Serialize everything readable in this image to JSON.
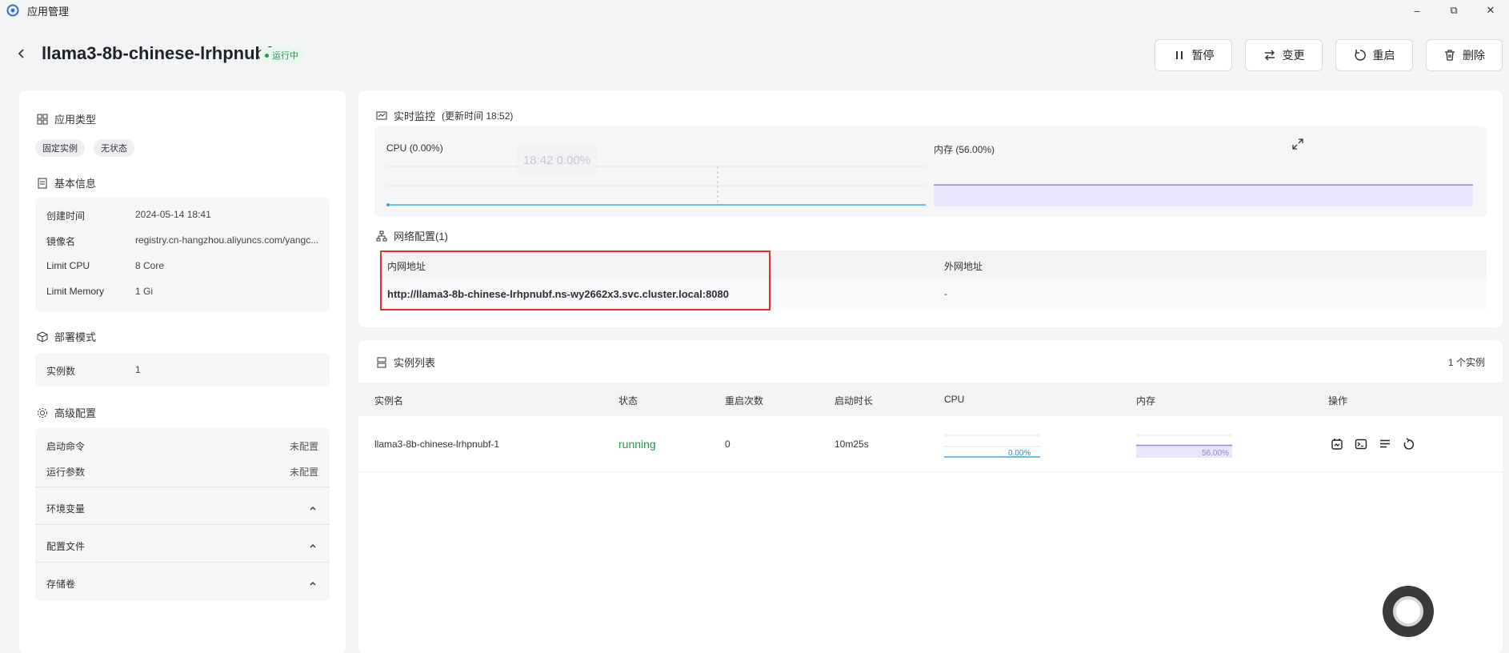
{
  "window": {
    "title": "应用管理",
    "minimize": "–",
    "restore": "⧉",
    "close": "✕"
  },
  "header": {
    "title": "llama3-8b-chinese-lrhpnubf",
    "status": "运行中",
    "buttons": {
      "pause": "暂停",
      "change": "变更",
      "restart": "重启",
      "delete": "删除"
    }
  },
  "left": {
    "app_type": {
      "title": "应用类型",
      "tags": [
        "固定实例",
        "无状态"
      ]
    },
    "basic": {
      "title": "基本信息",
      "rows": [
        {
          "k": "创建时间",
          "v": "2024-05-14 18:41"
        },
        {
          "k": "镜像名",
          "v": "registry.cn-hangzhou.aliyuncs.com/yangc..."
        },
        {
          "k": "Limit CPU",
          "v": "8 Core"
        },
        {
          "k": "Limit Memory",
          "v": "1 Gi"
        }
      ]
    },
    "deploy": {
      "title": "部署模式",
      "k": "实例数",
      "v": "1"
    },
    "advanced": {
      "title": "高级配置",
      "rows": [
        {
          "k": "启动命令",
          "v": "未配置"
        },
        {
          "k": "运行参数",
          "v": "未配置"
        }
      ],
      "collapses": [
        "环境变量",
        "配置文件",
        "存储卷"
      ]
    }
  },
  "monitor": {
    "title": "实时监控",
    "updated": "(更新时间 18:52)",
    "cpu_label": "CPU",
    "cpu_value": "(0.00%)",
    "mem_label": "内存",
    "mem_value": "(56.00%)",
    "tooltip": "18:42 0.00%",
    "cpu_fraction": 0.0,
    "mem_fraction": 0.56
  },
  "network": {
    "title": "网络配置(1)",
    "col_internal": "内网地址",
    "col_external": "外网地址",
    "internal": "http://llama3-8b-chinese-lrhpnubf.ns-wy2662x3.svc.cluster.local:8080",
    "external": "-"
  },
  "instances": {
    "title": "实例列表",
    "count": "1 个实例",
    "columns": [
      "实例名",
      "状态",
      "重启次数",
      "启动时长",
      "CPU",
      "内存",
      "操作"
    ],
    "rows": [
      {
        "name": "llama3-8b-chinese-lrhpnubf-1",
        "status": "running",
        "restarts": "0",
        "uptime": "10m25s",
        "cpu": "0.00%",
        "mem": "56.00%",
        "cpu_fraction": 0.0,
        "mem_fraction": 0.56
      }
    ]
  },
  "colors": {
    "accent": "#3aa7e0",
    "memory": "#8e86e8",
    "running": "#1a9c4b",
    "highlight": "#e03131"
  }
}
